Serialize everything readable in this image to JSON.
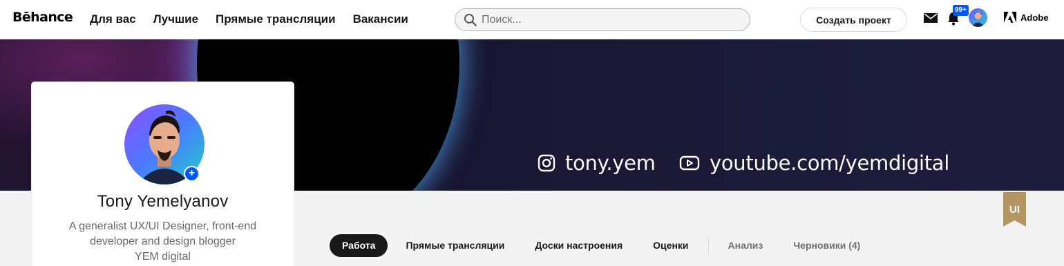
{
  "header": {
    "logo": "Bēhance",
    "nav": [
      "Для вас",
      "Лучшие",
      "Прямые трансляции",
      "Вакансии"
    ],
    "search_placeholder": "Поиск...",
    "create_label": "Создать проект",
    "notification_badge": "99+",
    "adobe_label": "Adobe"
  },
  "banner": {
    "instagram": "tony.yem",
    "youtube": "youtube.com/yemdigital"
  },
  "profile": {
    "name": "Tony Yemelyanov",
    "bio_line1": "A generalist UX/UI Designer, front-end",
    "bio_line2": "developer and design blogger",
    "bio_line3": "YEM digital"
  },
  "ribbon_label": "UI",
  "tabs": {
    "work": "Работа",
    "live": "Прямые трансляции",
    "moodboards": "Доски настроения",
    "appreciations": "Оценки",
    "analytics": "Анализ",
    "drafts": "Черновики (4)"
  },
  "colors": {
    "accent": "#0057ff",
    "ribbon": "#b39664",
    "active_tab": "#191919"
  }
}
